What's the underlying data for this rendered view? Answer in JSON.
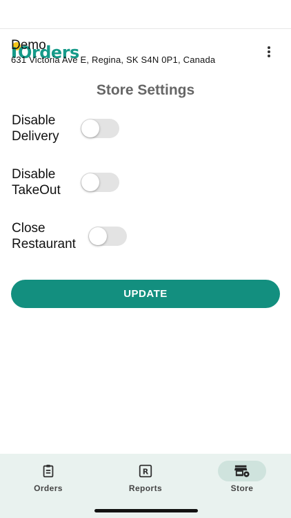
{
  "header": {
    "logo_text": "iOrders",
    "store_name": "Demo",
    "store_address": "631 Victoria Ave E, Regina, SK S4N 0P1, Canada",
    "menu_icon": "more-vert-icon"
  },
  "page": {
    "title": "Store Settings"
  },
  "settings": [
    {
      "label": "Disable\nDelivery",
      "enabled": false
    },
    {
      "label": "Disable\nTakeOut",
      "enabled": false
    },
    {
      "label": "Close\nRestaurant",
      "enabled": false
    }
  ],
  "update_button": {
    "label": "UPDATE"
  },
  "bottom_nav": {
    "items": [
      {
        "label": "Orders",
        "icon": "clipboard-icon",
        "active": false
      },
      {
        "label": "Reports",
        "icon": "report-icon",
        "active": false
      },
      {
        "label": "Store",
        "icon": "store-settings-icon",
        "active": true
      }
    ]
  },
  "colors": {
    "accent": "#138f7f",
    "logo": "#159a89",
    "logo_dot": "#f5c518",
    "nav_background": "#e9f2ef",
    "title_gray": "#666666"
  }
}
